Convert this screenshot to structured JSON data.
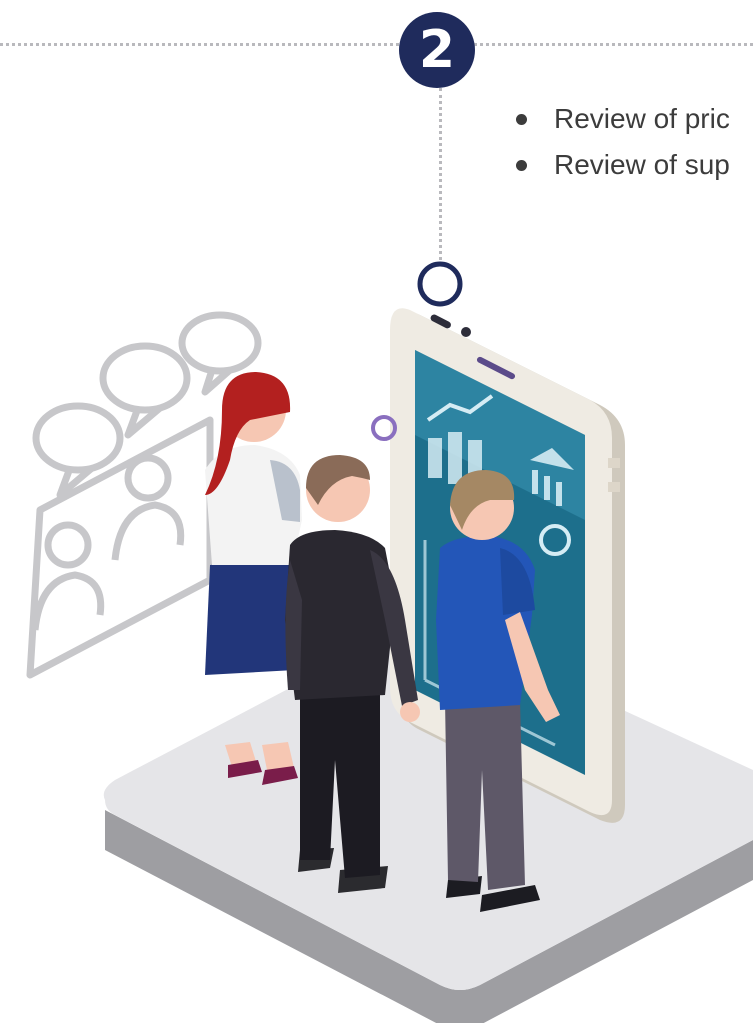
{
  "step": {
    "number": "2"
  },
  "bullets": [
    {
      "text": "Review of pric"
    },
    {
      "text": "Review of sup"
    }
  ],
  "colors": {
    "navy": "#1f2b5c",
    "dotted": "#b9b9bd",
    "screen": "#1d6f8c",
    "platform": "#e5e5e8",
    "accent_purple": "#8a6fbf"
  },
  "illustration": {
    "icons": [
      "speech-bubbles-icon",
      "people-icon",
      "bank-icon",
      "coin-icon",
      "chart-icon",
      "trend-arrow-icon"
    ]
  }
}
